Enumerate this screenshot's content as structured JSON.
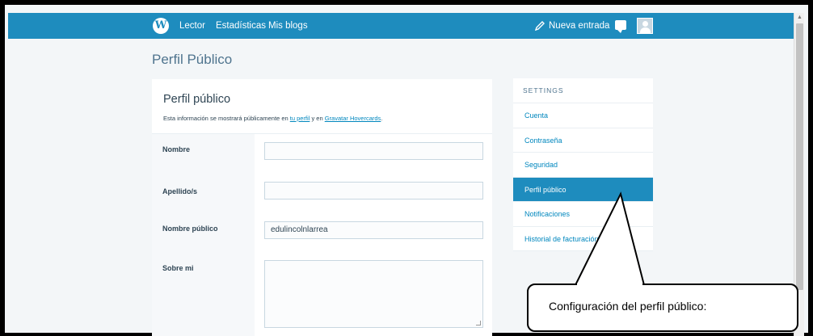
{
  "masterbar": {
    "nav": [
      "Lector",
      "Estadísticas",
      "Mis blogs"
    ],
    "new_post": "Nueva entrada"
  },
  "page_title": "Perfil Público",
  "card": {
    "title": "Perfil público",
    "desc_prefix": "Esta información se mostrará públicamente en ",
    "desc_link1": "tu perfil",
    "desc_middle": " y en ",
    "desc_link2": "Gravatar Hovercards",
    "desc_suffix": "."
  },
  "fields": {
    "nombre_label": "Nombre",
    "nombre_value": "",
    "apellido_label": "Apellido/s",
    "apellido_value": "",
    "publico_label": "Nombre público",
    "publico_value": "edulincolnlarrea",
    "sobre_label": "Sobre mi"
  },
  "settings": {
    "heading": "SETTINGS",
    "items": [
      "Cuenta",
      "Contraseña",
      "Seguridad",
      "Perfil público",
      "Notificaciones",
      "Historial de facturación"
    ],
    "active_index": 3
  },
  "annotation": {
    "text": "Configuración del perfil público:"
  },
  "colors": {
    "brand": "#1e8cbe",
    "link": "#0087be"
  }
}
